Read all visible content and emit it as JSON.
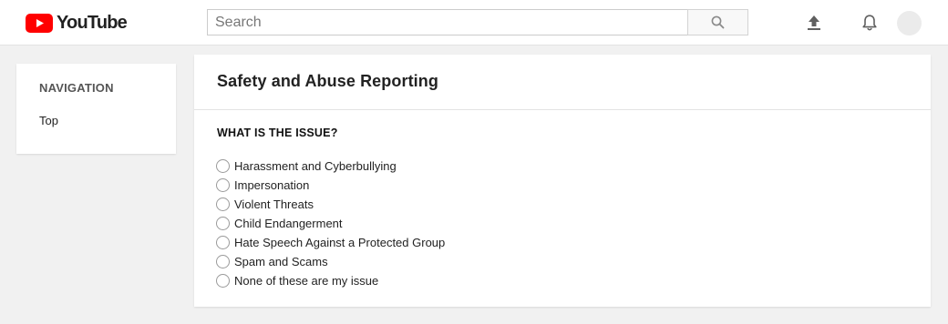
{
  "header": {
    "logo_text": "YouTube",
    "logo_color": "#ff0000",
    "search": {
      "placeholder": "Search",
      "value": ""
    },
    "search_icon": "search-icon",
    "upload_icon": "upload-icon",
    "notifications_icon": "bell-icon"
  },
  "sidebar": {
    "heading": "NAVIGATION",
    "items": [
      {
        "label": "Top"
      }
    ]
  },
  "main": {
    "title": "Safety and Abuse Reporting",
    "question": "WHAT IS THE ISSUE?",
    "options": [
      {
        "label": "Harassment and Cyberbullying",
        "selected": false
      },
      {
        "label": "Impersonation",
        "selected": false
      },
      {
        "label": "Violent Threats",
        "selected": false
      },
      {
        "label": "Child Endangerment",
        "selected": false
      },
      {
        "label": "Hate Speech Against a Protected Group",
        "selected": false
      },
      {
        "label": "Spam and Scams",
        "selected": false
      },
      {
        "label": "None of these are my issue",
        "selected": false
      }
    ]
  }
}
